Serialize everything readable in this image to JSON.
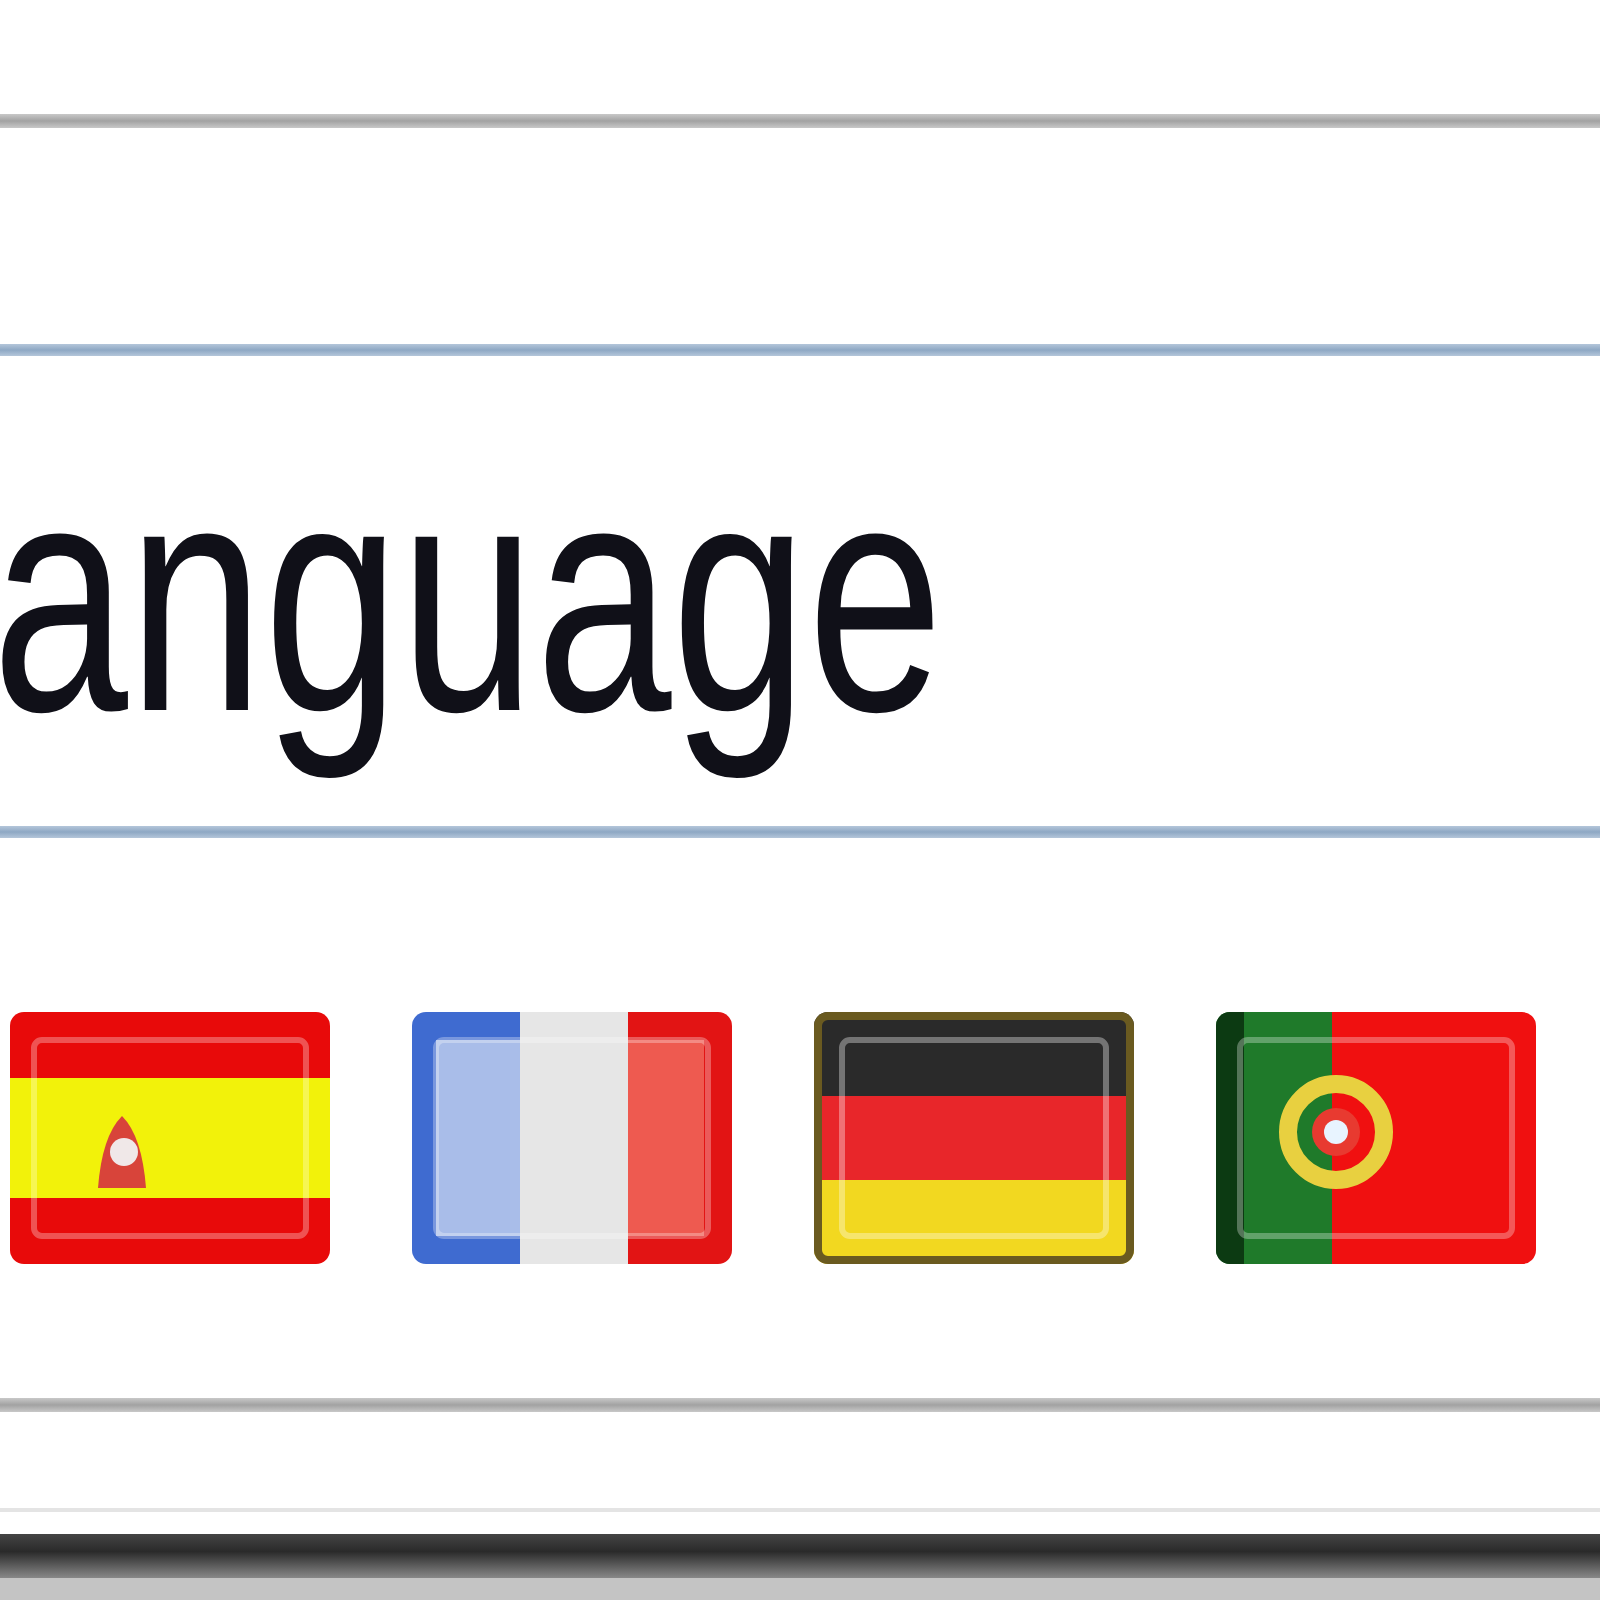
{
  "heading": "anguage",
  "flags": [
    {
      "kind": "spain"
    },
    {
      "kind": "france"
    },
    {
      "kind": "germany"
    },
    {
      "kind": "portugal"
    }
  ]
}
